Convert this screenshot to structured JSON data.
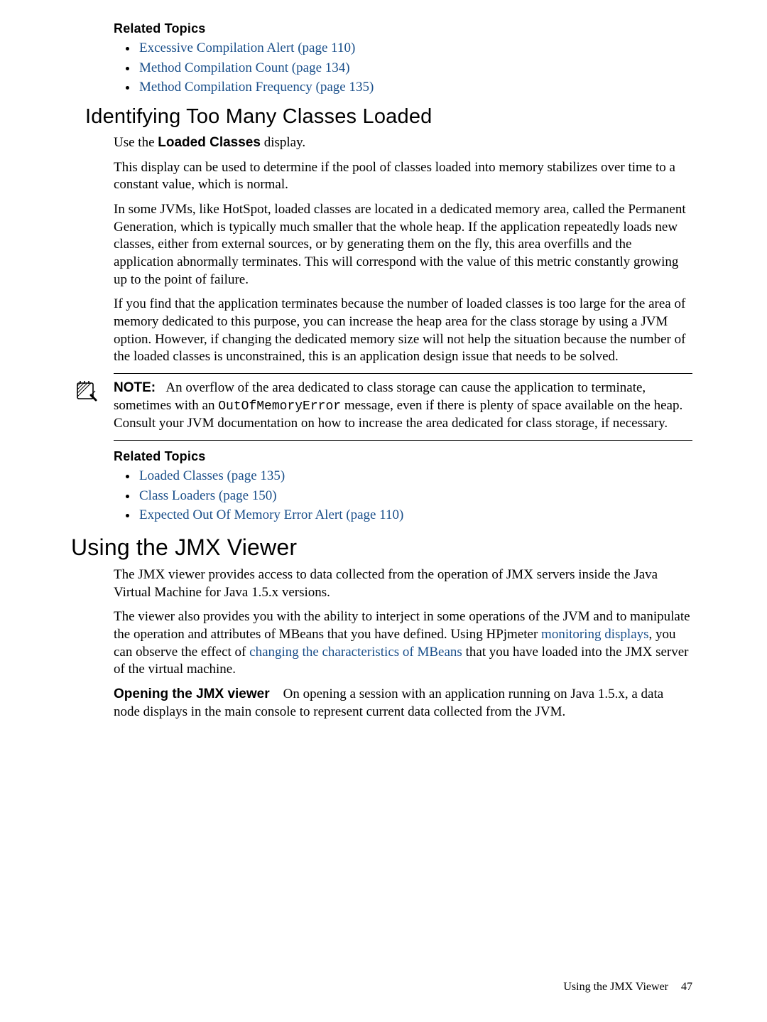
{
  "sectionA": {
    "relatedTopicsLabel": "Related Topics",
    "bullets": [
      "Excessive Compilation Alert (page 110)",
      "Method Compilation Count (page 134)",
      "Method Compilation Frequency (page 135)"
    ]
  },
  "sectionB": {
    "heading": "Identifying Too Many Classes Loaded",
    "p1_prefix": "Use the ",
    "p1_bold": "Loaded Classes",
    "p1_suffix": " display.",
    "p2": "This display can be used to determine if the pool of classes loaded into memory stabilizes over time to a constant value, which is normal.",
    "p3": "In some JVMs, like HotSpot, loaded classes are located in a dedicated memory area, called the Permanent Generation, which is typically much smaller that the whole heap. If the application repeatedly loads new classes, either from external sources, or by generating them on the fly, this area overfills and the application abnormally terminates. This will correspond with the value of this metric constantly growing up to the point of failure.",
    "p4": "If you find that the application terminates because the number of loaded classes is too large for the area of memory dedicated to this purpose, you can increase the heap area for the class storage by using a JVM option. However, if changing the dedicated memory size will not help the situation because the number of the loaded classes is unconstrained, this is an application design issue that needs to be solved.",
    "note_label": "NOTE:",
    "note_1": "An overflow of the area dedicated to class storage can cause the application to terminate, sometimes with an ",
    "note_code": "OutOfMemoryError",
    "note_2": " message, even if there is plenty of space available on the heap. Consult your JVM documentation on how to increase the area dedicated for class storage, if necessary.",
    "relatedTopicsLabel": "Related Topics",
    "bullets": [
      "Loaded Classes (page 135)",
      "Class Loaders (page 150)",
      "Expected Out Of Memory Error Alert (page 110)"
    ]
  },
  "sectionC": {
    "heading": "Using the JMX Viewer",
    "p1": "The JMX viewer provides access to data collected from the operation of JMX servers inside the Java Virtual Machine for Java 1.5.x versions.",
    "p2_1": "The viewer also provides you with the ability to interject in some operations of the JVM and to manipulate the operation and attributes of MBeans that you have defined. Using HPjmeter ",
    "p2_link1": "monitoring displays",
    "p2_2": ", you can observe the effect of ",
    "p2_link2": "changing the characteristics of MBeans",
    "p2_3": " that you have loaded into the JMX server of the virtual machine.",
    "p3_bold": "Opening the JMX viewer",
    "p3_rest": "On opening a session with an application running on Java 1.5.x, a data node displays in the main console to represent current data collected from the JVM."
  },
  "footer": {
    "title": "Using the JMX Viewer",
    "page": "47"
  }
}
